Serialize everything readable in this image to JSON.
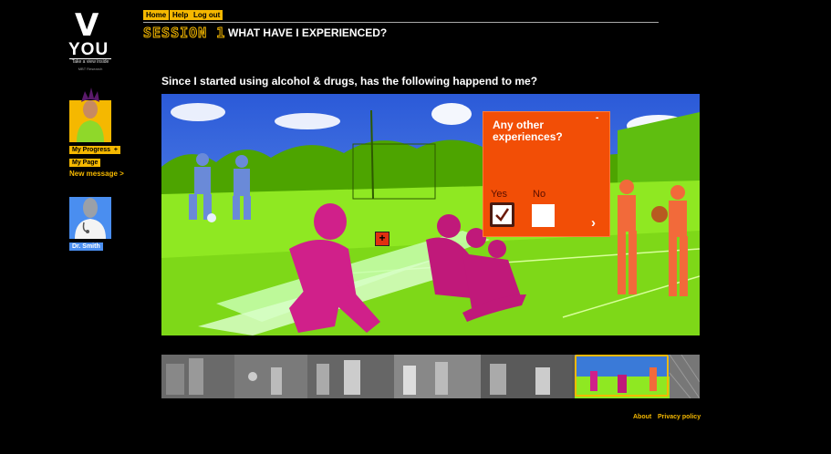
{
  "brand": {
    "logo_v": "V",
    "logo_you": "YOU",
    "tagline": "Take a view inside",
    "sub": "MBT Research"
  },
  "nav": {
    "home": "Home",
    "help": "Help",
    "logout": "Log out"
  },
  "session": {
    "word": "SESSION 1",
    "title": "WHAT HAVE I EXPERIENCED?"
  },
  "sidebar": {
    "my_progress": "My Progress",
    "my_progress_icon": "plus-icon",
    "my_page": "My Page",
    "new_message": "New message >",
    "doctor_name": "Dr. Smith"
  },
  "question": "Since I started using alcohol & drugs, has the following happend to me?",
  "popup": {
    "title": "Any other experiences?",
    "minimize": "-",
    "yes": "Yes",
    "no": "No",
    "yes_checked": true,
    "no_checked": false,
    "next_icon": "chevron-right-icon"
  },
  "hotspot": {
    "label": "+"
  },
  "filmstrip": {
    "frames": 6,
    "selected_index": 5
  },
  "footer": {
    "about": "About",
    "privacy": "Privacy policy"
  },
  "colors": {
    "accent": "#f5b800",
    "popup": "#f24e06",
    "scene_green": "#7ee81a",
    "scene_magenta": "#d0208a",
    "scene_orange": "#f26a3a",
    "scene_blue": "#6a8ad8",
    "doctor_badge": "#4a8ef0"
  }
}
